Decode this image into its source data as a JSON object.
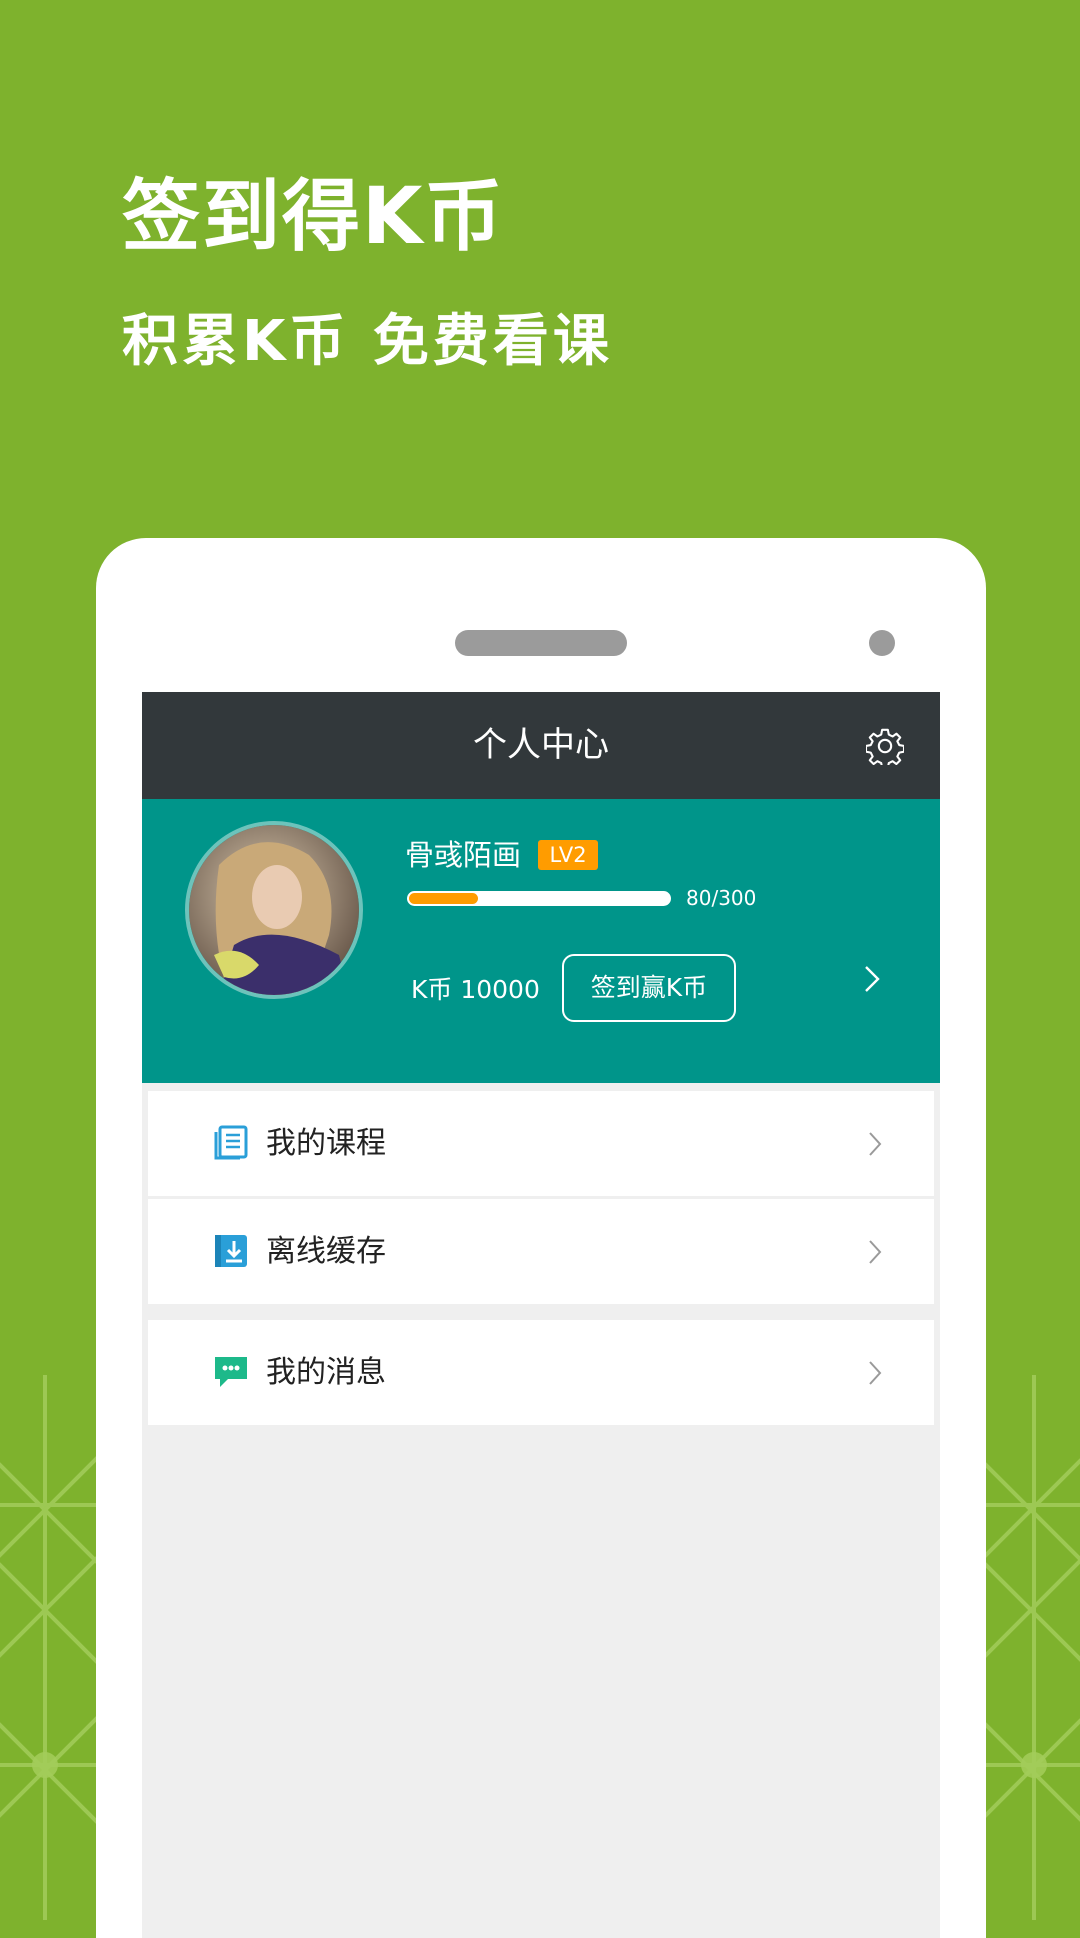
{
  "promo": {
    "title": "签到得K币",
    "subtitle": "积累K币 免费看课"
  },
  "app": {
    "header_title": "个人中心",
    "settings_icon": "gear-icon"
  },
  "profile": {
    "username": "骨彧陌画",
    "level": "LV2",
    "exp_text": "80/300",
    "exp_current": 80,
    "exp_max": 300,
    "coins_text": "K币 10000",
    "checkin_label": "签到赢K币"
  },
  "menu": [
    {
      "label": "我的课程",
      "icon": "book-icon"
    },
    {
      "label": "离线缓存",
      "icon": "download-icon"
    },
    {
      "label": "我的消息",
      "icon": "message-icon"
    }
  ],
  "colors": {
    "background": "#7eb22d",
    "header": "#32383b",
    "profile": "#00958a",
    "accent": "#ff9c00"
  }
}
